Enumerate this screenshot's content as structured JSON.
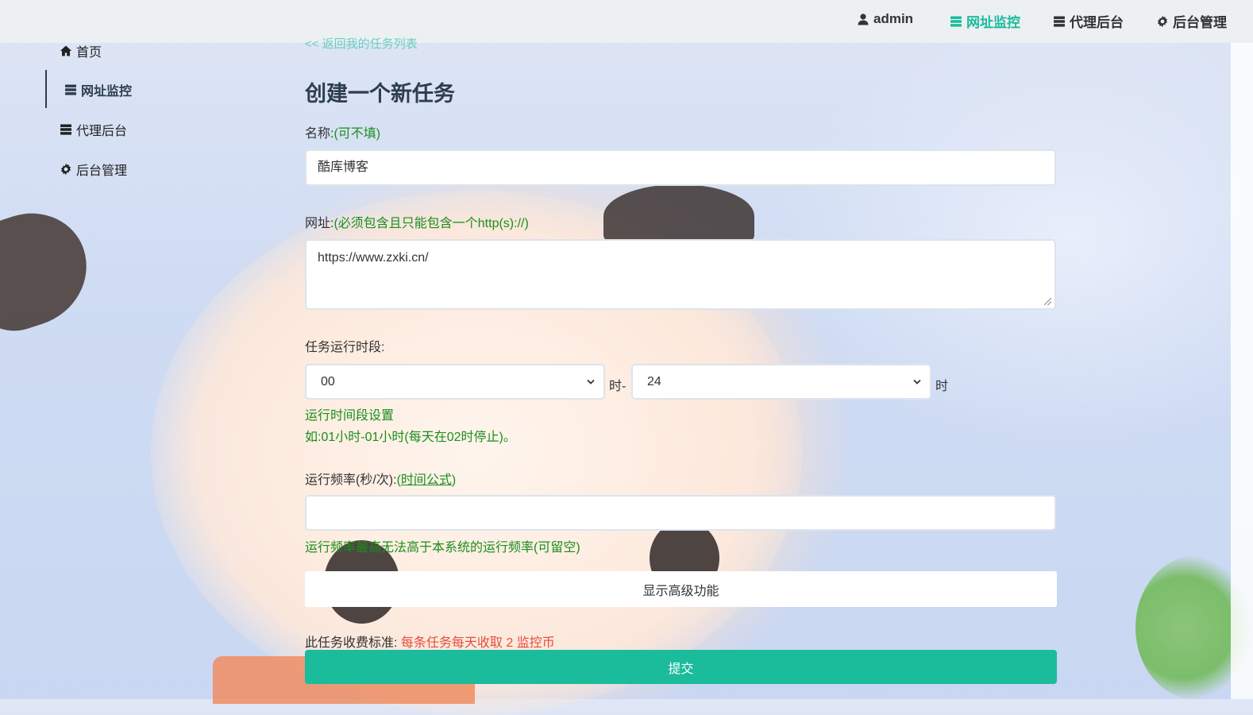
{
  "colors": {
    "accent": "#1abc9c",
    "hint_green": "#1a8f1a",
    "fee_red": "#e74c3c",
    "title": "#2c3e50"
  },
  "topnav": {
    "user": {
      "label": "admin",
      "icon": "user-icon"
    },
    "items": [
      {
        "label": "网址监控",
        "icon": "list-icon",
        "active": true
      },
      {
        "label": "代理后台",
        "icon": "list-icon",
        "active": false
      },
      {
        "label": "后台管理",
        "icon": "gear-icon",
        "active": false
      }
    ]
  },
  "sidebar": {
    "items": [
      {
        "label": "首页",
        "icon": "home-icon",
        "active": false
      },
      {
        "label": "网址监控",
        "icon": "list-icon",
        "active": true
      },
      {
        "label": "代理后台",
        "icon": "list-icon",
        "active": false
      },
      {
        "label": "后台管理",
        "icon": "gear-icon",
        "active": false
      }
    ]
  },
  "main": {
    "back_link": "<< 返回我的任务列表",
    "title": "创建一个新任务",
    "name_field": {
      "label": "名称:",
      "hint": "(可不填)",
      "value": "酷库博客"
    },
    "url_field": {
      "label": "网址:",
      "hint": "(必须包含且只能包含一个http(s)://)",
      "value": "https://www.zxki.cn/"
    },
    "time_range": {
      "label": "任务运行时段:",
      "start_value": "00",
      "start_suffix": "时-",
      "end_value": "24",
      "end_suffix": "时",
      "help_line1": "运行时间段设置",
      "help_line2": "如:01小时-01小时(每天在02时停止)。"
    },
    "frequency": {
      "label": "运行频率(秒/次):",
      "link_open": "(",
      "link_text": "时间公式",
      "link_close": ")",
      "value": "",
      "help": "运行频率最高无法高于本系统的运行频率(可留空)"
    },
    "advanced_button": "显示高级功能",
    "fee": {
      "label": "此任务收费标准:",
      "value": "每条任务每天收取 2 监控币"
    },
    "submit_button": "提交"
  }
}
